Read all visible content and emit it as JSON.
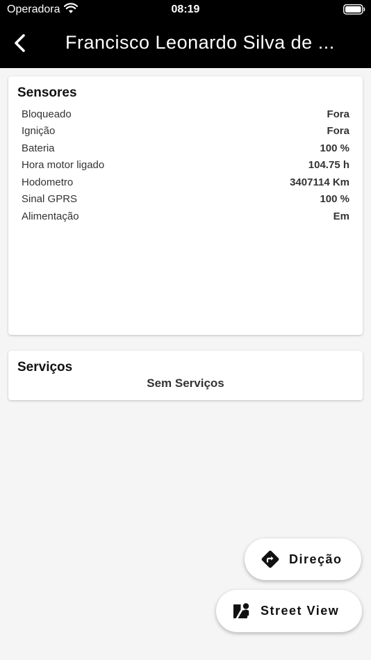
{
  "status_bar": {
    "carrier": "Operadora",
    "time": "08:19"
  },
  "header": {
    "title": "Francisco Leonardo Silva de ...",
    "back_icon": "chevron-left-icon"
  },
  "sensors": {
    "title": "Sensores",
    "rows": [
      {
        "label": "Bloqueado",
        "value": "Fora"
      },
      {
        "label": "Ignição",
        "value": "Fora"
      },
      {
        "label": "Bateria",
        "value": "100 %"
      },
      {
        "label": "Hora motor ligado",
        "value": "104.75 h"
      },
      {
        "label": "Hodometro",
        "value": "3407114 Km"
      },
      {
        "label": "Sinal GPRS",
        "value": "100 %"
      },
      {
        "label": "Alimentação",
        "value": "Em"
      }
    ]
  },
  "services": {
    "title": "Serviços",
    "empty_text": "Sem Serviços"
  },
  "actions": {
    "direction_label": "Direção",
    "direction_icon": "directions-icon",
    "street_view_label": "Street View",
    "street_view_icon": "street-view-icon"
  },
  "colors": {
    "header_bg": "#000000",
    "page_bg": "#f5f5f5",
    "card_bg": "#ffffff"
  }
}
